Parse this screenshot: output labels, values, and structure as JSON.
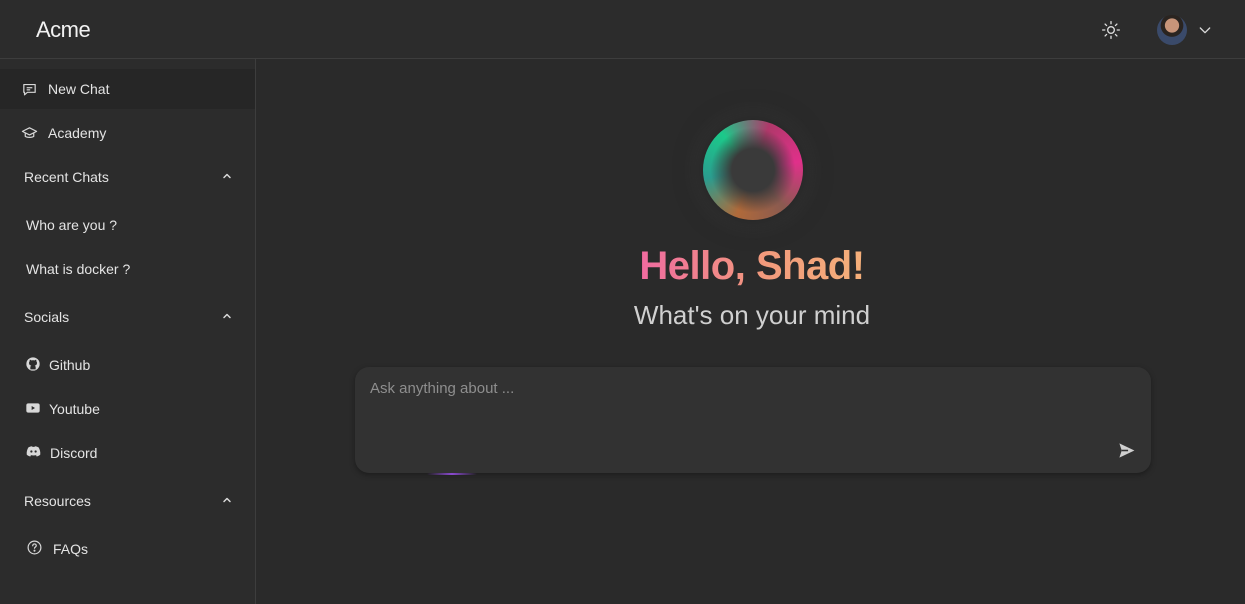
{
  "header": {
    "brand": "Acme",
    "theme_toggle_icon": "sun-icon",
    "avatar_icon": "avatar",
    "user_menu_chevron": "chevron-down-icon"
  },
  "sidebar": {
    "new_chat": "New Chat",
    "academy": "Academy",
    "recent_chats": {
      "label": "Recent Chats",
      "items": [
        "Who are you ?",
        "What is docker ?"
      ]
    },
    "socials": {
      "label": "Socials",
      "items": [
        "Github",
        "Youtube",
        "Discord"
      ]
    },
    "resources": {
      "label": "Resources",
      "items": [
        "FAQs"
      ]
    }
  },
  "main": {
    "greeting": "Hello, Shad!",
    "subtitle": "What's on your mind",
    "input_placeholder": "Ask anything about ...",
    "input_value": ""
  },
  "colors": {
    "background": "#2a2a2a",
    "sidebar": "#2c2c2c",
    "greeting_gradient_start": "#f06aa0",
    "greeting_gradient_end": "#f5b07a"
  }
}
